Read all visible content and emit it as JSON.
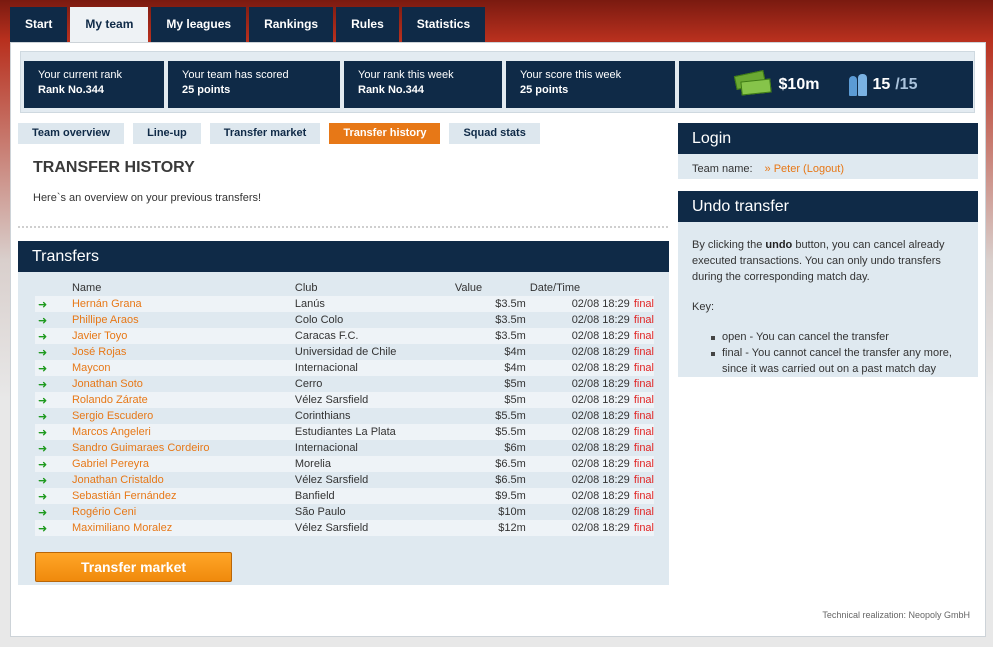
{
  "nav": {
    "tabs": [
      {
        "label": "Start"
      },
      {
        "label": "My team"
      },
      {
        "label": "My leagues"
      },
      {
        "label": "Rankings"
      },
      {
        "label": "Rules"
      },
      {
        "label": "Statistics"
      }
    ],
    "active": "My team"
  },
  "stats": {
    "current_rank_label": "Your current rank",
    "current_rank_value": "Rank No.344",
    "scored_label": "Your team has scored",
    "scored_value": "25 points",
    "week_rank_label": "Your rank this week",
    "week_rank_value": "Rank No.344",
    "week_score_label": "Your score this week",
    "week_score_value": "25 points",
    "budget": "$10m",
    "squad_count": "15",
    "squad_max": "/15"
  },
  "subtabs": [
    {
      "label": "Team overview"
    },
    {
      "label": "Line-up"
    },
    {
      "label": "Transfer market"
    },
    {
      "label": "Transfer history"
    },
    {
      "label": "Squad stats"
    }
  ],
  "page": {
    "title": "TRANSFER HISTORY",
    "intro": "Here`s an overview on your previous transfers!"
  },
  "transfers": {
    "heading": "Transfers",
    "columns": {
      "name": "Name",
      "club": "Club",
      "value": "Value",
      "date": "Date/Time"
    },
    "rows": [
      {
        "name": "Hernán Grana",
        "club": "Lanús",
        "value": "$3.5m",
        "date": "02/08 18:29",
        "status": "final"
      },
      {
        "name": "Phillipe Araos",
        "club": "Colo Colo",
        "value": "$3.5m",
        "date": "02/08 18:29",
        "status": "final"
      },
      {
        "name": "Javier Toyo",
        "club": "Caracas F.C.",
        "value": "$3.5m",
        "date": "02/08 18:29",
        "status": "final"
      },
      {
        "name": "José Rojas",
        "club": "Universidad de Chile",
        "value": "$4m",
        "date": "02/08 18:29",
        "status": "final"
      },
      {
        "name": "Maycon",
        "club": "Internacional",
        "value": "$4m",
        "date": "02/08 18:29",
        "status": "final"
      },
      {
        "name": "Jonathan Soto",
        "club": "Cerro",
        "value": "$5m",
        "date": "02/08 18:29",
        "status": "final"
      },
      {
        "name": "Rolando Zárate",
        "club": "Vélez Sarsfield",
        "value": "$5m",
        "date": "02/08 18:29",
        "status": "final"
      },
      {
        "name": "Sergio Escudero",
        "club": "Corinthians",
        "value": "$5.5m",
        "date": "02/08 18:29",
        "status": "final"
      },
      {
        "name": "Marcos Angeleri",
        "club": "Estudiantes La Plata",
        "value": "$5.5m",
        "date": "02/08 18:29",
        "status": "final"
      },
      {
        "name": "Sandro Guimaraes Cordeiro",
        "club": "Internacional",
        "value": "$6m",
        "date": "02/08 18:29",
        "status": "final"
      },
      {
        "name": "Gabriel Pereyra",
        "club": "Morelia",
        "value": "$6.5m",
        "date": "02/08 18:29",
        "status": "final"
      },
      {
        "name": "Jonathan Cristaldo",
        "club": "Vélez Sarsfield",
        "value": "$6.5m",
        "date": "02/08 18:29",
        "status": "final"
      },
      {
        "name": "Sebastián Fernández",
        "club": "Banfield",
        "value": "$9.5m",
        "date": "02/08 18:29",
        "status": "final"
      },
      {
        "name": "Rogério Ceni",
        "club": "São Paulo",
        "value": "$10m",
        "date": "02/08 18:29",
        "status": "final"
      },
      {
        "name": "Maximiliano Moralez",
        "club": "Vélez Sarsfield",
        "value": "$12m",
        "date": "02/08 18:29",
        "status": "final"
      }
    ],
    "button_label": "Transfer market"
  },
  "login": {
    "heading": "Login",
    "team_label": "Team name:",
    "team_value": "» Peter (Logout)"
  },
  "undo": {
    "heading": "Undo transfer",
    "text_before": "By clicking the ",
    "text_bold": "undo",
    "text_after": " button, you can cancel already executed transactions. You can only undo transfers during the corresponding match day.",
    "key_label": "Key:",
    "key_open": "open - You can cancel the transfer",
    "key_final": "final - You cannot cancel the transfer any more, since it was carried out on a past match day"
  },
  "footer": {
    "credit": "Technical realization: Neopoly GmbH"
  }
}
